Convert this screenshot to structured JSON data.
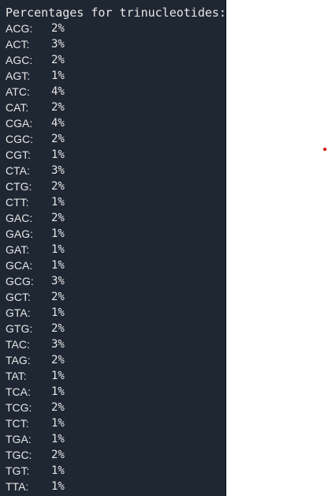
{
  "terminal": {
    "header": "Percentages for trinucleotides:",
    "rows": [
      {
        "tri": "ACG:",
        "pct": "2%"
      },
      {
        "tri": "ACT:",
        "pct": "3%"
      },
      {
        "tri": "AGC:",
        "pct": "2%"
      },
      {
        "tri": "AGT:",
        "pct": "1%"
      },
      {
        "tri": "ATC:",
        "pct": "4%"
      },
      {
        "tri": "CAT:",
        "pct": "2%"
      },
      {
        "tri": "CGA:",
        "pct": "4%"
      },
      {
        "tri": "CGC:",
        "pct": "2%"
      },
      {
        "tri": "CGT:",
        "pct": "1%"
      },
      {
        "tri": "CTA:",
        "pct": "3%"
      },
      {
        "tri": "CTG:",
        "pct": "2%"
      },
      {
        "tri": "CTT:",
        "pct": "1%"
      },
      {
        "tri": "GAC:",
        "pct": "2%"
      },
      {
        "tri": "GAG:",
        "pct": "1%"
      },
      {
        "tri": "GAT:",
        "pct": "1%"
      },
      {
        "tri": "GCA:",
        "pct": "1%"
      },
      {
        "tri": "GCG:",
        "pct": "3%"
      },
      {
        "tri": "GCT:",
        "pct": "2%"
      },
      {
        "tri": "GTA:",
        "pct": "1%"
      },
      {
        "tri": "GTG:",
        "pct": "2%"
      },
      {
        "tri": "TAC:",
        "pct": "3%"
      },
      {
        "tri": "TAG:",
        "pct": "2%"
      },
      {
        "tri": "TAT:",
        "pct": "1%"
      },
      {
        "tri": "TCA:",
        "pct": "1%"
      },
      {
        "tri": "TCG:",
        "pct": "2%"
      },
      {
        "tri": "TCT:",
        "pct": "1%"
      },
      {
        "tri": "TGA:",
        "pct": "1%"
      },
      {
        "tri": "TGC:",
        "pct": "2%"
      },
      {
        "tri": "TGT:",
        "pct": "1%"
      },
      {
        "tri": "TTA:",
        "pct": "1%"
      }
    ]
  },
  "colors": {
    "terminal_bg": "#1f2733",
    "terminal_text": "#e6e6e6",
    "page_bg": "#ffffff",
    "marker": "#d10000"
  }
}
